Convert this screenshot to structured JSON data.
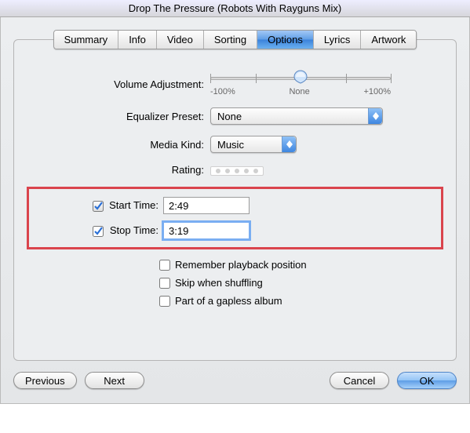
{
  "window": {
    "title": "Drop The Pressure (Robots With Rayguns Mix)"
  },
  "tabs": [
    "Summary",
    "Info",
    "Video",
    "Sorting",
    "Options",
    "Lyrics",
    "Artwork"
  ],
  "selected_tab_index": 4,
  "volume": {
    "label": "Volume Adjustment:",
    "ticks": {
      "left": "-100%",
      "center": "None",
      "right": "+100%"
    }
  },
  "eq": {
    "label": "Equalizer Preset:",
    "value": "None"
  },
  "media_kind": {
    "label": "Media Kind:",
    "value": "Music"
  },
  "rating": {
    "label": "Rating:"
  },
  "start_time": {
    "label": "Start Time:",
    "value": "2:49",
    "checked": true
  },
  "stop_time": {
    "label": "Stop Time:",
    "value": "3:19",
    "checked": true
  },
  "options": {
    "remember": {
      "label": "Remember playback position",
      "checked": false
    },
    "skip": {
      "label": "Skip when shuffling",
      "checked": false
    },
    "gapless": {
      "label": "Part of a gapless album",
      "checked": false
    }
  },
  "buttons": {
    "previous": "Previous",
    "next": "Next",
    "cancel": "Cancel",
    "ok": "OK"
  }
}
